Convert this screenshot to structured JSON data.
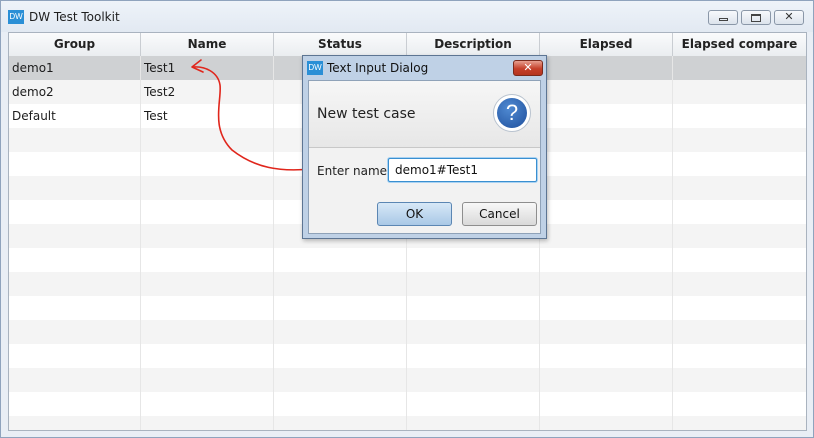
{
  "window": {
    "icon_text": "DW",
    "title": "DW Test Toolkit"
  },
  "table": {
    "columns": [
      "Group",
      "Name",
      "Status",
      "Description",
      "Elapsed",
      "Elapsed compare"
    ],
    "rows": [
      {
        "group": "demo1",
        "name": "Test1",
        "status": "",
        "description": "",
        "elapsed": "",
        "elapsed_compare": ""
      },
      {
        "group": "demo2",
        "name": "Test2",
        "status": "",
        "description": "",
        "elapsed": "",
        "elapsed_compare": ""
      },
      {
        "group": "Default",
        "name": "Test",
        "status": "",
        "description": "",
        "elapsed": "",
        "elapsed_compare": ""
      }
    ],
    "selected_row": 0
  },
  "dialog": {
    "icon_text": "DW",
    "title": "Text Input Dialog",
    "message": "New test case",
    "help_glyph": "?",
    "close_glyph": "✕",
    "field_label": "Enter name",
    "field_value": "demo1#Test1",
    "ok_label": "OK",
    "cancel_label": "Cancel"
  },
  "annotation_color": "#e0261c"
}
